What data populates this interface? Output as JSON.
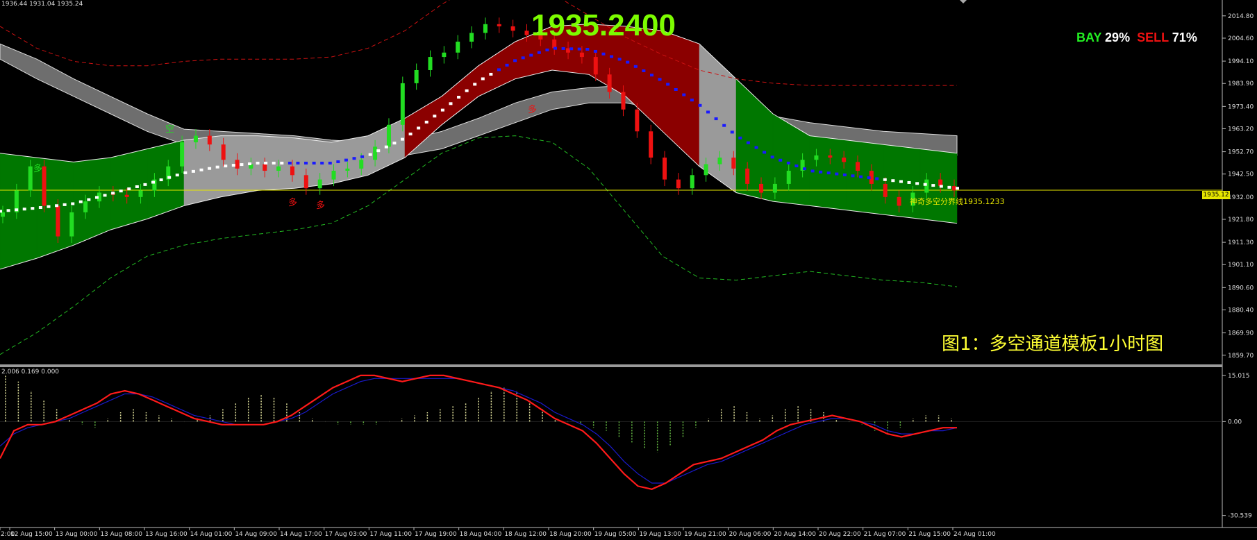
{
  "header": {
    "ohlc_text": "1936.44 1931.04 1935.24",
    "big_price": "1935.2400",
    "bay_label": "BAY",
    "bay_pct": "29%",
    "sell_label": "SELL",
    "sell_pct": "71%"
  },
  "annotations": {
    "figure_caption": "图1：多空通道模板1小时图",
    "divider_label": "神奇多空分界线1935.1233",
    "current_price_tag": "1935.12",
    "signal_markers": [
      "多",
      "多",
      "多",
      "多",
      "空"
    ],
    "oscillator_label": "2.006 0.169 0.000"
  },
  "colors": {
    "background": "#000000",
    "bull_candle": "#22dd22",
    "bear_candle": "#ee1111",
    "bull_channel": "#007700",
    "bear_channel": "#8b0000",
    "neutral_channel": "#9a9a9a",
    "grey_band": "#6e6e6e",
    "blue_dots": "#1a1aff",
    "white_dots": "#ffffff",
    "magenta_marks": "#ee00ee",
    "divider_line": "#e6e600",
    "macd_line": "#ff1a1a",
    "signal_line": "#1a1acc",
    "hist_positive": "#e6e6a0",
    "hist_negative": "#66bb44",
    "axis_text": "#dddddd"
  },
  "chart_data": [
    {
      "type": "candlestick",
      "title": "",
      "y_axis_ticks": [
        "2014.80",
        "2004.60",
        "1994.10",
        "1983.90",
        "1973.40",
        "1963.20",
        "1952.70",
        "1942.50",
        "1932.00",
        "1921.80",
        "1911.30",
        "1901.10",
        "1890.60",
        "1880.40",
        "1869.90",
        "1859.70"
      ],
      "x_axis_ticks": [
        "2:00",
        "12 Aug 15:00",
        "13 Aug 00:00",
        "13 Aug 08:00",
        "13 Aug 16:00",
        "14 Aug 01:00",
        "14 Aug 09:00",
        "14 Aug 17:00",
        "17 Aug 03:00",
        "17 Aug 11:00",
        "17 Aug 19:00",
        "18 Aug 04:00",
        "18 Aug 12:00",
        "18 Aug 20:00",
        "19 Aug 05:00",
        "19 Aug 13:00",
        "19 Aug 21:00",
        "20 Aug 06:00",
        "20 Aug 14:00",
        "20 Aug 22:00",
        "21 Aug 07:00",
        "21 Aug 15:00",
        "24 Aug 01:00"
      ],
      "ylim": [
        1855.5,
        2019.5
      ],
      "divider_level": 1935.1233,
      "last_price": 1935.12,
      "price_path": [
        1925,
        1935,
        1946,
        1928,
        1914,
        1925,
        1930,
        1934,
        1933,
        1932,
        1935,
        1940,
        1946,
        1957,
        1960,
        1956,
        1949,
        1945,
        1947,
        1944,
        1946,
        1942,
        1936,
        1940,
        1944,
        1945,
        1949,
        1955,
        1965,
        1984,
        1990,
        1996,
        1998,
        2003,
        2007,
        2011,
        2010,
        2008,
        2006,
        2004,
        2000,
        1998,
        1996,
        1988,
        1980,
        1972,
        1962,
        1950,
        1940,
        1936,
        1942,
        1947,
        1950,
        1945,
        1938,
        1934,
        1938,
        1944,
        1949,
        1951,
        1950,
        1948,
        1944,
        1938,
        1932,
        1928,
        1934,
        1940,
        1937,
        1935
      ],
      "channel_upper": [
        1952,
        1950,
        1948,
        1950,
        1954,
        1958,
        1960,
        1960,
        1959,
        1957,
        1960,
        1968,
        1978,
        1992,
        2003,
        2010,
        2011,
        2010,
        2008,
        2002,
        1986,
        1970,
        1960,
        1958,
        1956,
        1954,
        1952
      ],
      "channel_lower": [
        1899,
        1904,
        1910,
        1917,
        1922,
        1928,
        1932,
        1935,
        1936,
        1938,
        1942,
        1950,
        1965,
        1978,
        1986,
        1990,
        1988,
        1978,
        1962,
        1946,
        1934,
        1930,
        1928,
        1926,
        1924,
        1922,
        1920
      ],
      "grey_band_upper": [
        2002,
        1995,
        1986,
        1978,
        1970,
        1963,
        1962,
        1961,
        1960,
        1958,
        1957,
        1958,
        1962,
        1968,
        1975,
        1980,
        1982,
        1983,
        1980,
        1977,
        1973,
        1969,
        1966,
        1964,
        1962,
        1961,
        1960
      ],
      "grey_band_lower": [
        1995,
        1986,
        1978,
        1970,
        1962,
        1956,
        1955,
        1954,
        1952,
        1950,
        1950,
        1951,
        1954,
        1960,
        1966,
        1972,
        1975,
        1975,
        1972,
        1968,
        1963,
        1960,
        1957,
        1955,
        1953,
        1952,
        1951
      ],
      "outer_upper_dashed": [
        2010,
        2000,
        1994,
        1992,
        1992,
        1994,
        1995,
        1995,
        1995,
        1996,
        2000,
        2008,
        2020,
        2030,
        2030,
        2025,
        2015,
        2005,
        1997,
        1990,
        1986,
        1984,
        1983,
        1983,
        1983,
        1983,
        1983
      ],
      "outer_lower_dashed": [
        1860,
        1870,
        1882,
        1895,
        1905,
        1910,
        1913,
        1915,
        1917,
        1920,
        1928,
        1940,
        1952,
        1959,
        1960,
        1957,
        1945,
        1925,
        1905,
        1895,
        1894,
        1896,
        1898,
        1896,
        1894,
        1893,
        1891
      ]
    },
    {
      "type": "line",
      "title": "",
      "y_axis_ticks": [
        "15.015",
        "0.00",
        "-30.539"
      ],
      "ylim": [
        -34,
        17
      ],
      "series": [
        {
          "values": [
            -12,
            -3,
            -1,
            -1,
            0,
            2,
            4,
            6,
            9,
            10,
            9,
            7,
            5,
            3,
            1,
            0,
            -1,
            -1,
            -1,
            -1,
            0,
            2,
            5,
            8,
            11,
            13,
            15,
            15,
            14,
            13,
            14,
            15,
            15,
            14,
            13,
            12,
            11,
            9,
            7,
            4,
            1,
            -1,
            -3,
            -7,
            -12,
            -17,
            -21,
            -22,
            -20,
            -17,
            -14,
            -13,
            -12,
            -10,
            -8,
            -6,
            -3,
            -1,
            0,
            1,
            2,
            1,
            0,
            -2,
            -4,
            -5,
            -4,
            -3,
            -2,
            -2
          ]
        },
        {
          "values": [
            -8,
            -4,
            -2,
            -1,
            0,
            1,
            3,
            5,
            7,
            9,
            9,
            8,
            6,
            4,
            2,
            1,
            0,
            -1,
            -1,
            -1,
            0,
            1,
            3,
            6,
            9,
            11,
            13,
            14,
            14,
            14,
            14,
            14,
            14,
            14,
            13,
            12,
            11,
            10,
            8,
            6,
            3,
            1,
            -1,
            -4,
            -8,
            -13,
            -17,
            -20,
            -20,
            -18,
            -16,
            -14,
            -13,
            -11,
            -9,
            -7,
            -5,
            -3,
            -1,
            0,
            1,
            1,
            0,
            -1,
            -3,
            -4,
            -4,
            -3,
            -3,
            -2
          ]
        }
      ],
      "histogram": [
        15,
        13,
        10,
        7,
        4,
        1,
        -1,
        -2,
        1,
        3,
        4,
        3,
        2,
        1,
        0,
        1,
        2,
        4,
        6,
        8,
        9,
        8,
        6,
        3,
        1,
        0,
        -1,
        -1,
        -1,
        -1,
        0,
        1,
        2,
        3,
        4,
        5,
        6,
        8,
        10,
        11,
        10,
        7,
        4,
        1,
        0,
        -1,
        -2,
        -3,
        -5,
        -7,
        -9,
        -10,
        -8,
        -5,
        -2,
        1,
        4,
        5,
        3,
        1,
        2,
        4,
        5,
        4,
        3,
        1,
        0,
        -1,
        -3,
        -4,
        -2,
        1,
        2,
        2,
        1
      ],
      "zero_line": 0.0
    }
  ]
}
